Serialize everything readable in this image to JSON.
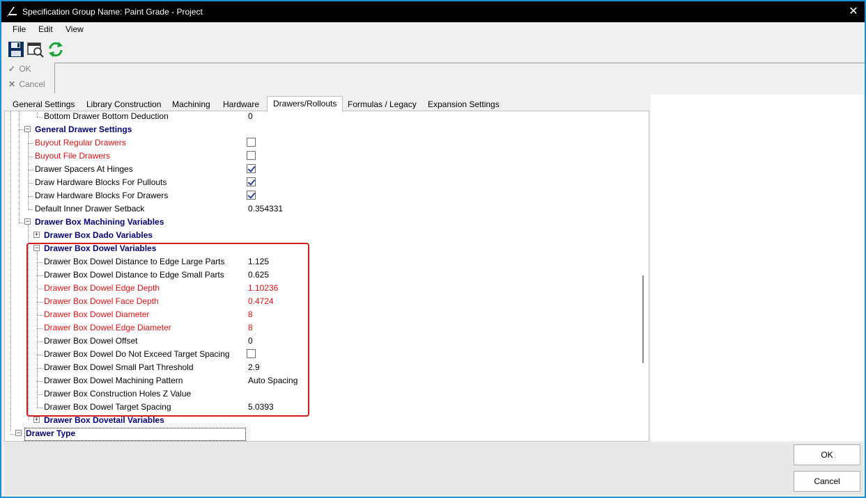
{
  "window": {
    "title": "Specification Group Name: Paint Grade - Project",
    "close_glyph": "✕"
  },
  "menu": [
    "File",
    "Edit",
    "View"
  ],
  "toolbar": {
    "icons": [
      "save-icon",
      "print-preview-icon",
      "refresh-icon"
    ]
  },
  "quick_buttons": {
    "ok": "OK",
    "cancel": "Cancel",
    "ok_glyph": "✓",
    "cancel_glyph": "✕"
  },
  "tabs": [
    "General Settings",
    "Library Construction",
    "Machining",
    "Hardware",
    "Drawers/Rollouts",
    "Formulas / Legacy",
    "Expansion Settings"
  ],
  "active_tab": "Drawers/Rollouts",
  "grid": {
    "rows": [
      {
        "label": "Bottom Drawer Bottom Deduction",
        "value": "0"
      },
      {
        "label": "General Drawer Settings"
      },
      {
        "label": "Buyout Regular Drawers",
        "checked": false
      },
      {
        "label": "Buyout File Drawers",
        "checked": false
      },
      {
        "label": "Drawer Spacers At Hinges",
        "checked": true
      },
      {
        "label": "Draw Hardware Blocks For Pullouts",
        "checked": true
      },
      {
        "label": "Draw Hardware Blocks For Drawers",
        "checked": true
      },
      {
        "label": "Default Inner Drawer Setback",
        "value": "0.354331"
      },
      {
        "label": "Drawer Box Machining Variables"
      },
      {
        "label": "Drawer Box Dado Variables"
      },
      {
        "label": "Drawer Box Dowel Variables"
      },
      {
        "label": "Drawer Box Dowel Distance to Edge Large Parts",
        "value": "1.125"
      },
      {
        "label": "Drawer Box Dowel Distance to Edge Small Parts",
        "value": "0.625"
      },
      {
        "label": "Drawer Box Dowel Edge Depth",
        "value": "1.10236"
      },
      {
        "label": "Drawer Box Dowel Face Depth",
        "value": "0.4724"
      },
      {
        "label": "Drawer Box Dowel Diameter",
        "value": "8"
      },
      {
        "label": "Drawer Box Dowel Edge Diameter",
        "value": "8"
      },
      {
        "label": "Drawer Box Dowel Offset",
        "value": "0"
      },
      {
        "label": "Drawer Box Dowel Do Not Exceed Target Spacing",
        "checked": false
      },
      {
        "label": "Drawer Box Dowel Small Part Threshold",
        "value": "2.9"
      },
      {
        "label": "Drawer Box Dowel Machining Pattern",
        "value": "Auto Spacing"
      },
      {
        "label": "Drawer Box Construction Holes Z Value",
        "value": ""
      },
      {
        "label": "Drawer Box Dowel Target Spacing",
        "value": "5.0393"
      },
      {
        "label": "Drawer Box Dovetail Variables"
      },
      {
        "label": "Drawer Type"
      }
    ],
    "expander_collapsed": "+",
    "expander_expanded": "−"
  },
  "footer": {
    "ok": "OK",
    "cancel": "Cancel"
  },
  "colors": {
    "accent_border": "#1c8fd9",
    "category_text": "#00007a",
    "modified_text": "#e01010",
    "highlight_box": "#d41c1c"
  }
}
